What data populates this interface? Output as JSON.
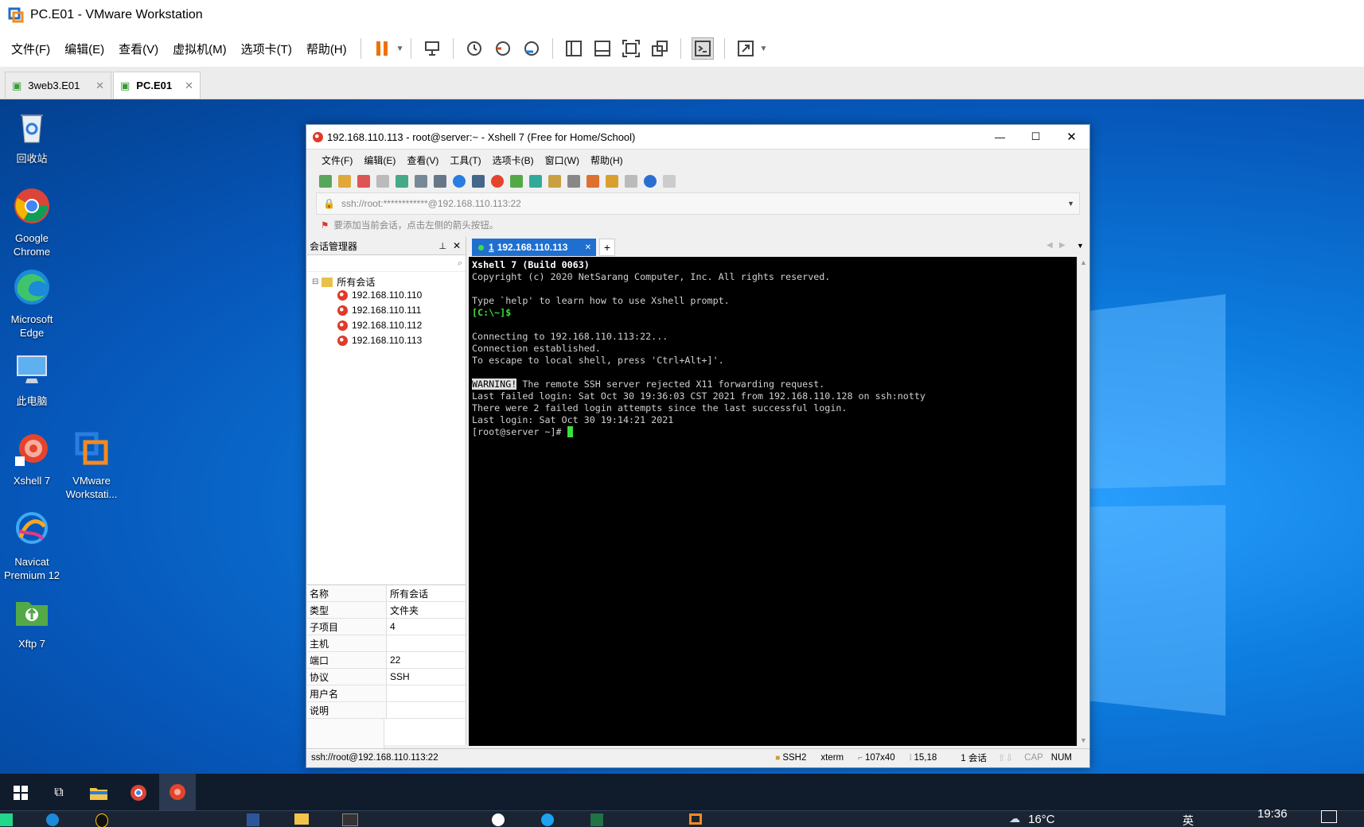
{
  "vmware": {
    "window_title": "PC.E01 - VMware Workstation",
    "menu": [
      "文件(F)",
      "编辑(E)",
      "查看(V)",
      "虚拟机(M)",
      "选项卡(T)",
      "帮助(H)"
    ],
    "tabs": [
      {
        "label": "3web3.E01",
        "active": false
      },
      {
        "label": "PC.E01",
        "active": true
      }
    ]
  },
  "desktop": {
    "icons": [
      {
        "label": "回收站",
        "icon": "recycle-bin-icon"
      },
      {
        "label": "Google Chrome",
        "icon": "chrome-icon"
      },
      {
        "label": "Microsoft Edge",
        "icon": "edge-icon"
      },
      {
        "label": "此电脑",
        "icon": "computer-icon"
      },
      {
        "label": "Xshell 7",
        "icon": "xshell-icon"
      },
      {
        "label": "VMware Workstati...",
        "icon": "vmware-icon"
      },
      {
        "label": "Navicat Premium 12",
        "icon": "navicat-icon"
      },
      {
        "label": "Xftp 7",
        "icon": "xftp-icon"
      }
    ]
  },
  "xshell": {
    "window_title": "192.168.110.113 - root@server:~ - Xshell 7 (Free for Home/School)",
    "menu": [
      "文件(F)",
      "编辑(E)",
      "查看(V)",
      "工具(T)",
      "选项卡(B)",
      "窗口(W)",
      "帮助(H)"
    ],
    "address": "ssh://root:************@192.168.110.113:22",
    "hint": "要添加当前会话，点击左侧的箭头按钮。",
    "session_manager": {
      "title": "会话管理器",
      "root": "所有会话",
      "sessions": [
        "192.168.110.110",
        "192.168.110.111",
        "192.168.110.112",
        "192.168.110.113"
      ]
    },
    "properties": [
      {
        "k": "名称",
        "v": "所有会话"
      },
      {
        "k": "类型",
        "v": "文件夹"
      },
      {
        "k": "子项目",
        "v": "4"
      },
      {
        "k": "主机",
        "v": ""
      },
      {
        "k": "端口",
        "v": "22"
      },
      {
        "k": "协议",
        "v": "SSH"
      },
      {
        "k": "用户名",
        "v": ""
      },
      {
        "k": "说明",
        "v": ""
      }
    ],
    "tab": {
      "number": "1",
      "label": "192.168.110.113"
    },
    "terminal": {
      "line1": "Xshell 7 (Build 0063)",
      "line2": "Copyright (c) 2020 NetSarang Computer, Inc. All rights reserved.",
      "line3": "Type `help' to learn how to use Xshell prompt.",
      "line4": "[C:\\~]$",
      "line5": "Connecting to 192.168.110.113:22...",
      "line6": "Connection established.",
      "line7": "To escape to local shell, press 'Ctrl+Alt+]'.",
      "warning": "WARNING!",
      "line8": " The remote SSH server rejected X11 forwarding request.",
      "line9": "Last failed login: Sat Oct 30 19:36:03 CST 2021 from 192.168.110.128 on ssh:notty",
      "line10": "There were 2 failed login attempts since the last successful login.",
      "line11": "Last login: Sat Oct 30 19:14:21 2021",
      "prompt": "[root@server ~]# "
    },
    "status": {
      "connection": "ssh://root@192.168.110.113:22",
      "protocol": "SSH2",
      "term": "xterm",
      "size": "107x40",
      "cursor": "15,18",
      "sessions": "1 会话",
      "cap": "CAP",
      "num": "NUM"
    }
  },
  "taskbar": {
    "weather": "16°C",
    "ime": "英",
    "time": "19:36"
  }
}
